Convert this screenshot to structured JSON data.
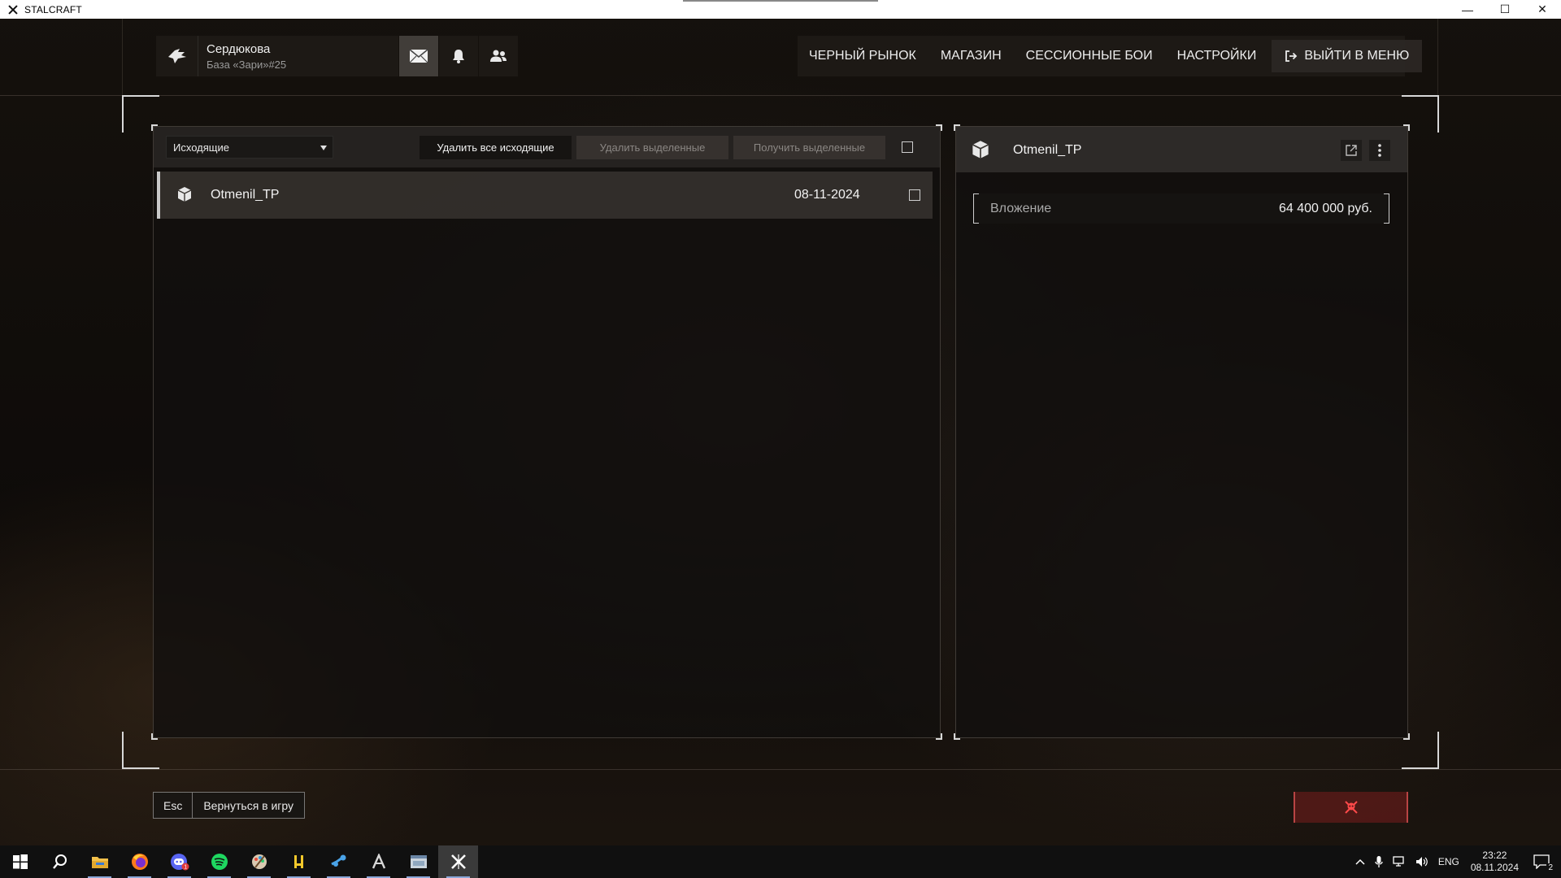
{
  "window": {
    "title": "STALCRAFT",
    "controls": [
      "—",
      "☐",
      "✕"
    ]
  },
  "profile": {
    "name": "Сердюкова",
    "base": "База «Зари»#25"
  },
  "nav": {
    "items": [
      "ЧЕРНЫЙ РЫНОК",
      "МАГАЗИН",
      "СЕССИОННЫЕ БОИ",
      "НАСТРОЙКИ"
    ],
    "exit_label": "ВЫЙТИ В МЕНЮ"
  },
  "mail": {
    "folder_selected": "Исходящие",
    "delete_all_label": "Удалить все исходящие",
    "delete_selected_label": "Удалить выделенные",
    "receive_selected_label": "Получить выделенные",
    "messages": [
      {
        "sender": "Otmenil_TP",
        "date": "08-11-2024"
      }
    ]
  },
  "detail": {
    "sender": "Otmenil_TP",
    "attachment_label": "Вложение",
    "attachment_value": "64 400 000 руб."
  },
  "footer": {
    "key": "Esc",
    "action": "Вернуться в игру"
  },
  "taskbar": {
    "lang": "ENG",
    "time": "23:22",
    "date": "08.11.2024",
    "notifications": "2",
    "apps": [
      "windows-start",
      "search",
      "file-explorer",
      "firefox",
      "discord",
      "spotify",
      "paint",
      "launcher",
      "steam",
      "arc",
      "app",
      "stalcraft"
    ]
  },
  "colors": {
    "accent_danger": "#b84444",
    "panel_bg": "#121010",
    "text": "#e6e6e6"
  }
}
